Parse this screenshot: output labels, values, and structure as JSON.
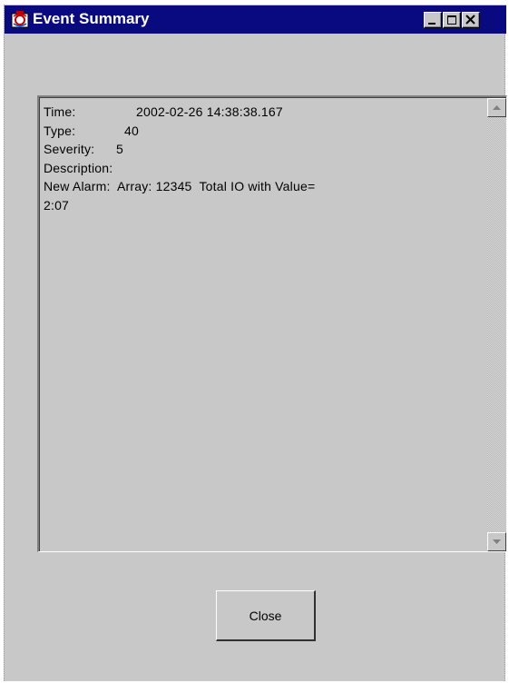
{
  "window": {
    "title": "Event Summary",
    "icons": {
      "app": "app-icon",
      "minimize": "minimize-icon",
      "maximize": "maximize-icon",
      "close": "close-icon"
    }
  },
  "summary": {
    "lines": [
      {
        "label": "Time:",
        "value": "2002-02-26 14:38:38.167"
      },
      {
        "label": "Type:",
        "value": "40"
      },
      {
        "label": "Severity:",
        "value": "5"
      },
      {
        "label": "Description:",
        "value": ""
      },
      {
        "label": "",
        "value": "New Alarm:  Array: 12345  Total IO with Value="
      },
      {
        "label": "",
        "value": "2:07"
      }
    ]
  },
  "scrollbar": {
    "up_icon": "scroll-up-arrow-icon",
    "down_icon": "scroll-down-arrow-icon"
  },
  "buttons": {
    "close_label": "Close"
  },
  "colors": {
    "titlebar": "#0a0a80",
    "window_bg": "#c8c8c8",
    "title_text": "#ffffff"
  }
}
